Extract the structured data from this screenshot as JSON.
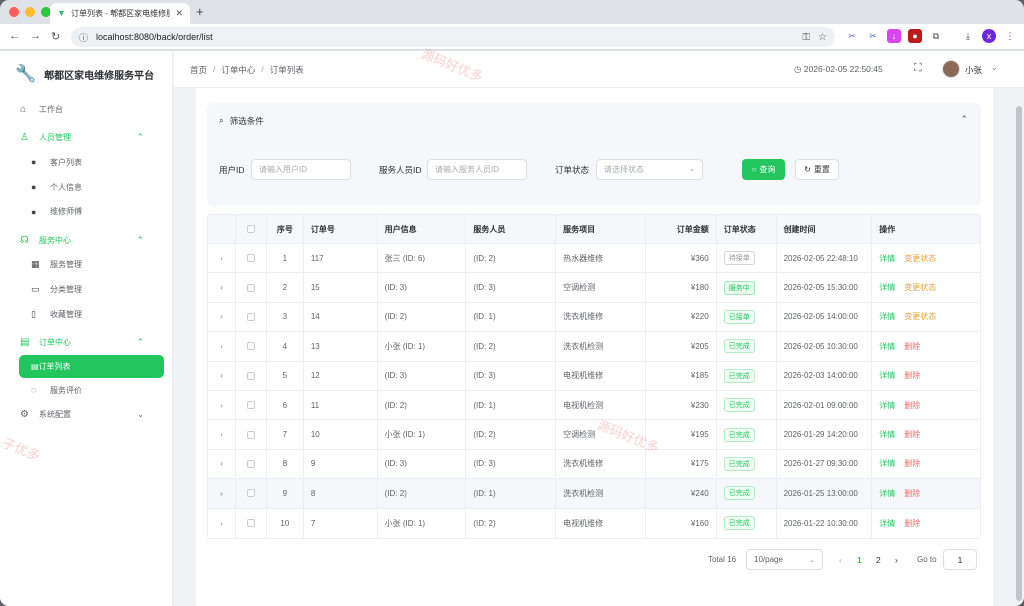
{
  "browser": {
    "tab_title": "订单列表 - 郫都区家电维修服务",
    "url": "localhost:8080/back/order/list"
  },
  "sidebar": {
    "brand": "郫都区家电维修服务平台",
    "items": [
      {
        "label": "工作台",
        "icon": "home-icon",
        "level": "top"
      },
      {
        "label": "人员管理",
        "icon": "user-icon",
        "level": "group"
      },
      {
        "label": "客户列表",
        "icon": "person-icon",
        "level": "sub"
      },
      {
        "label": "个人信息",
        "icon": "person-icon",
        "level": "sub"
      },
      {
        "label": "维修师傅",
        "icon": "person-icon",
        "level": "sub"
      },
      {
        "label": "服务中心",
        "icon": "headset-icon",
        "level": "group"
      },
      {
        "label": "服务管理",
        "icon": "grid-icon",
        "level": "sub"
      },
      {
        "label": "分类管理",
        "icon": "folder-icon",
        "level": "sub"
      },
      {
        "label": "收藏管理",
        "icon": "bookmark-icon",
        "level": "sub"
      },
      {
        "label": "订单中心",
        "icon": "document-icon",
        "level": "group"
      },
      {
        "label": "订单列表",
        "icon": "document-icon",
        "level": "active"
      },
      {
        "label": "服务评价",
        "icon": "chat-icon",
        "level": "sub"
      },
      {
        "label": "系统配置",
        "icon": "gear-icon",
        "level": "group-collapsed"
      }
    ]
  },
  "header": {
    "breadcrumb": [
      "首页",
      "订单中心",
      "订单列表"
    ],
    "datetime": "2026-02-05 22:50:45",
    "username": "小张"
  },
  "filter": {
    "title": "筛选条件",
    "user_id_label": "用户ID",
    "user_id_placeholder": "请输入用户ID",
    "staff_id_label": "服务人员ID",
    "staff_id_placeholder": "请输入服务人员ID",
    "status_label": "订单状态",
    "status_placeholder": "请选择状态",
    "query_button": "查询",
    "reset_button": "重置"
  },
  "table": {
    "columns": [
      "序号",
      "订单号",
      "用户信息",
      "服务人员",
      "服务项目",
      "订单金额",
      "订单状态",
      "创建时间",
      "操作"
    ],
    "rows": [
      {
        "idx": "1",
        "order": "117",
        "user": "张三 (ID: 6)",
        "staff": "(ID: 2)",
        "service": "热水器维修",
        "amount": "¥360",
        "status": "待接单",
        "status_kind": "pending",
        "time": "2026-02-05 22:48:10",
        "actions": [
          "详情",
          "变更状态"
        ]
      },
      {
        "idx": "2",
        "order": "15",
        "user": "(ID: 3)",
        "staff": "(ID: 3)",
        "service": "空调检测",
        "amount": "¥180",
        "status": "服务中",
        "status_kind": "serving",
        "time": "2026-02-05 15:30:00",
        "actions": [
          "详情",
          "变更状态"
        ]
      },
      {
        "idx": "3",
        "order": "14",
        "user": "(ID: 2)",
        "staff": "(ID: 1)",
        "service": "洗衣机维修",
        "amount": "¥220",
        "status": "已接单",
        "status_kind": "accepted",
        "time": "2026-02-05 14:00:00",
        "actions": [
          "详情",
          "变更状态"
        ]
      },
      {
        "idx": "4",
        "order": "13",
        "user": "小张 (ID: 1)",
        "staff": "(ID: 2)",
        "service": "洗衣机检测",
        "amount": "¥205",
        "status": "已完成",
        "status_kind": "done",
        "time": "2026-02-05 10:30:00",
        "actions": [
          "详情",
          "删除"
        ]
      },
      {
        "idx": "5",
        "order": "12",
        "user": "(ID: 3)",
        "staff": "(ID: 3)",
        "service": "电视机维修",
        "amount": "¥185",
        "status": "已完成",
        "status_kind": "done",
        "time": "2026-02-03 14:00:00",
        "actions": [
          "详情",
          "删除"
        ]
      },
      {
        "idx": "6",
        "order": "11",
        "user": "(ID: 2)",
        "staff": "(ID: 1)",
        "service": "电视机检测",
        "amount": "¥230",
        "status": "已完成",
        "status_kind": "done",
        "time": "2026-02-01 09:00:00",
        "actions": [
          "详情",
          "删除"
        ]
      },
      {
        "idx": "7",
        "order": "10",
        "user": "小张 (ID: 1)",
        "staff": "(ID: 2)",
        "service": "空调检测",
        "amount": "¥195",
        "status": "已完成",
        "status_kind": "done",
        "time": "2026-01-29 14:20:00",
        "actions": [
          "详情",
          "删除"
        ]
      },
      {
        "idx": "8",
        "order": "9",
        "user": "(ID: 3)",
        "staff": "(ID: 3)",
        "service": "洗衣机维修",
        "amount": "¥175",
        "status": "已完成",
        "status_kind": "done",
        "time": "2026-01-27 09:30:00",
        "actions": [
          "详情",
          "删除"
        ]
      },
      {
        "idx": "9",
        "order": "8",
        "user": "(ID: 2)",
        "staff": "(ID: 1)",
        "service": "洗衣机检测",
        "amount": "¥240",
        "status": "已完成",
        "status_kind": "done",
        "time": "2026-01-25 13:00:00",
        "actions": [
          "详情",
          "删除"
        ]
      },
      {
        "idx": "10",
        "order": "7",
        "user": "小张 (ID: 1)",
        "staff": "(ID: 2)",
        "service": "电视机维修",
        "amount": "¥160",
        "status": "已完成",
        "status_kind": "done",
        "time": "2026-01-22 10:30:00",
        "actions": [
          "详情",
          "删除"
        ]
      }
    ]
  },
  "pagination": {
    "total": "Total 16",
    "page_size": "10/page",
    "pages": [
      "1",
      "2"
    ],
    "current": "1",
    "goto_label": "Go to",
    "goto_value": "1"
  },
  "watermark": [
    "源码好优多",
    "子优多"
  ],
  "colors": {
    "accent": "#22c55e",
    "warning": "#e6a23c",
    "danger": "#f56c6c"
  }
}
